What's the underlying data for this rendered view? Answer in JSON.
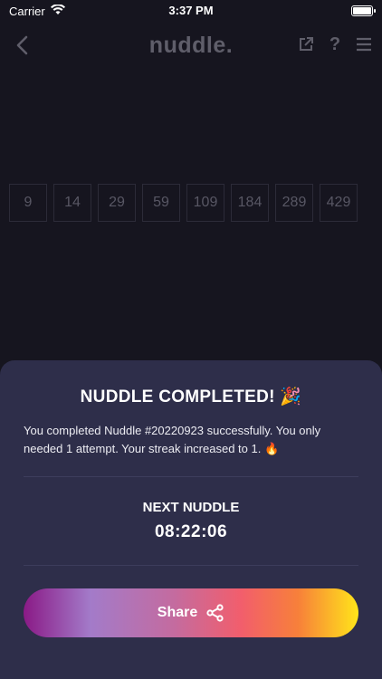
{
  "status_bar": {
    "carrier": "Carrier",
    "time": "3:37 PM"
  },
  "nav": {
    "brand": "nuddle."
  },
  "sequence": {
    "numbers": [
      "9",
      "14",
      "29",
      "59",
      "109",
      "184",
      "289",
      "429"
    ]
  },
  "result_sheet": {
    "title": "NUDDLE COMPLETED! 🎉",
    "message": "You completed Nuddle #20220923 successfully. You only needed 1 attempt. Your streak increased to 1. 🔥",
    "next_label": "NEXT NUDDLE",
    "countdown": "08:22:06",
    "share_label": "Share"
  },
  "colors": {
    "background": "#16151f",
    "sheet": "#2e2e4a",
    "share_gradient": [
      "#8a1a86",
      "#a37bc9",
      "#f25e6c",
      "#ffe51a"
    ]
  }
}
